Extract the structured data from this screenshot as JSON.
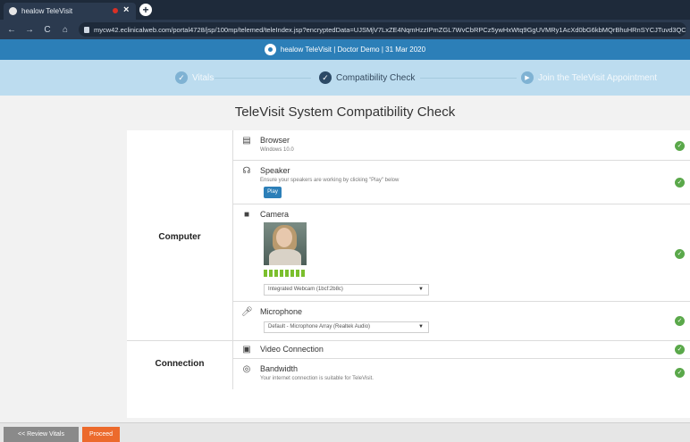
{
  "browser": {
    "tab_title": "healow TeleVisit",
    "tab_close": "×",
    "new_tab": "+",
    "url": "mycw42.eclinicalweb.com/portal4728/jsp/100mp/telemed/teleIndex.jsp?encryptedData=UJSMjV7LxZE4NqmHzzIPmZGL7WvCbRPCz5ywHxWtq9GgUVMRy1AcXd0bG6kbMQrBhuHRnSYCJTuvd3QCUEcQ4Bu…",
    "nav": {
      "back": "←",
      "forward": "→",
      "reload": "C",
      "home": "⌂"
    }
  },
  "header": {
    "text": "healow TeleVisit | Doctor Demo | 31 Mar 2020"
  },
  "stepper": {
    "steps": [
      {
        "label": "Vitals",
        "glyph": "✓"
      },
      {
        "label": "Compatibility Check",
        "glyph": "✓"
      },
      {
        "label": "Join the TeleVisit Appointment",
        "glyph": "▶"
      }
    ]
  },
  "page": {
    "title": "TeleVisit System Compatibility Check"
  },
  "groups": {
    "computer": "Computer",
    "connection": "Connection"
  },
  "checks": {
    "browser": {
      "title": "Browser",
      "sub": "Windows 10.0"
    },
    "speaker": {
      "title": "Speaker",
      "sub": "Ensure your speakers are working by clicking \"Play\" below",
      "play": "Play"
    },
    "camera": {
      "title": "Camera",
      "device": "Integrated Webcam (1bcf:2b8c)"
    },
    "microphone": {
      "title": "Microphone",
      "device": "Default - Microphone Array (Realtek Audio)"
    },
    "video": {
      "title": "Video Connection"
    },
    "bandwidth": {
      "title": "Bandwidth",
      "sub": "Your internet connection is suitable for TeleVisit."
    }
  },
  "status_glyph": "✓",
  "mic_level_segments": 8,
  "footer": {
    "review": "<< Review Vitals",
    "proceed": "Proceed"
  },
  "colors": {
    "brand_blue": "#2c7fb8",
    "step_done": "#7fb2d3",
    "step_active": "#2c4a66",
    "ok_green": "#5aa84a",
    "proceed_orange": "#ec6a2c",
    "review_gray": "#8a8a8a"
  },
  "icons": {
    "browser": "browser-icon",
    "speaker": "headphones-icon",
    "camera": "camera-icon",
    "microphone": "microphone-icon",
    "video": "video-connection-icon",
    "bandwidth": "bandwidth-icon"
  }
}
